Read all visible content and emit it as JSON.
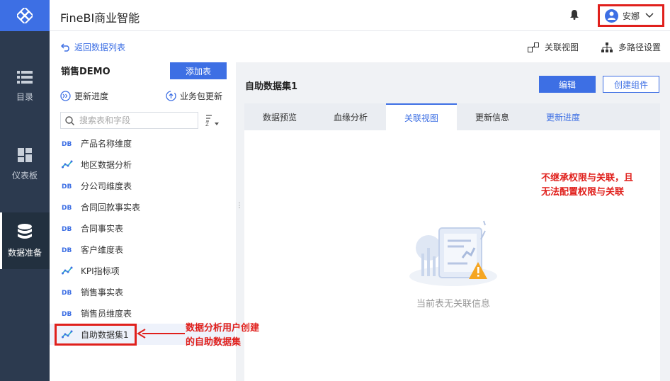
{
  "app": {
    "title": "FineBI商业智能"
  },
  "nav": {
    "items": [
      {
        "label": "目录",
        "icon": "list-icon"
      },
      {
        "label": "仪表板",
        "icon": "dashboard-icon"
      },
      {
        "label": "数据准备",
        "icon": "database-icon",
        "active": true
      }
    ]
  },
  "header": {
    "user_name": "安娜"
  },
  "toolbar": {
    "back_label": "返回数据列表",
    "relation_view_label": "关联视图",
    "multipath_label": "多路径设置"
  },
  "left_panel": {
    "title": "销售DEMO",
    "add_table_label": "添加表",
    "update_progress_label": "更新进度",
    "package_update_label": "业务包更新",
    "search_placeholder": "搜索表和字段",
    "tables": [
      {
        "label": "产品名称维度",
        "type": "db"
      },
      {
        "label": "地区数据分析",
        "type": "self-service"
      },
      {
        "label": "分公司维度表",
        "type": "db"
      },
      {
        "label": "合同回款事实表",
        "type": "db"
      },
      {
        "label": "合同事实表",
        "type": "db"
      },
      {
        "label": "客户维度表",
        "type": "db"
      },
      {
        "label": "KPI指标项",
        "type": "self-service"
      },
      {
        "label": "销售事实表",
        "type": "db"
      },
      {
        "label": "销售员维度表",
        "type": "db"
      },
      {
        "label": "自助数据集1",
        "type": "self-service",
        "selected": true
      }
    ]
  },
  "dataset": {
    "title": "自助数据集1",
    "edit_label": "编辑",
    "create_component_label": "创建组件",
    "tabs": [
      {
        "label": "数据预览"
      },
      {
        "label": "血缘分析"
      },
      {
        "label": "关联视图",
        "active": true
      },
      {
        "label": "更新信息"
      },
      {
        "label": "更新进度",
        "link": true
      }
    ],
    "empty_text": "当前表无关联信息"
  },
  "annotations": {
    "right_line1": "不继承权限与关联，且",
    "right_line2": "无法配置权限与关联",
    "left_line1": "数据分析用户创建",
    "left_line2": "的自助数据集"
  },
  "colors": {
    "accent": "#3d6fe4",
    "nav_bg": "#2c3a4f",
    "annotation": "#e0201c"
  }
}
